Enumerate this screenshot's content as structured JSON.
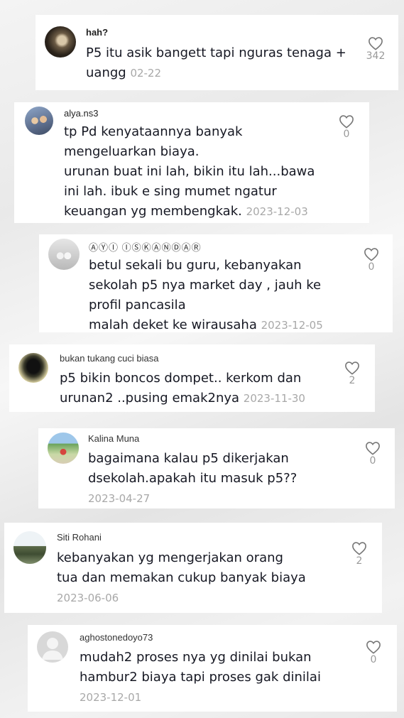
{
  "comments": [
    {
      "username": "hah?",
      "text": "P5 itu asik bangett tapi nguras tenaga +\nuangg",
      "date": "02-22",
      "likes": "342",
      "avatar": "user-photo"
    },
    {
      "username": "alya.ns3",
      "text": "tp Pd kenyataannya banyak\nmengeluarkan biaya.\nurunan buat ini lah, bikin itu lah...bawa\nini lah. ibuk e sing mumet ngatur\nkeuangan yg membengkak.",
      "date": "2023-12-03",
      "likes": "0",
      "avatar": "couple-photo"
    },
    {
      "username": "ⒶⓎⒾ ⒾⓈⓀⒶⓃⒹⒶⓇ",
      "text": "betul sekali bu guru, kebanyakan\nsekolah p5 nya market day , jauh ke\nprofil pancasila\nmalah deket ke wirausaha",
      "date": "2023-12-05",
      "likes": "0",
      "avatar": "couple-photo"
    },
    {
      "username": "bukan tukang cuci biasa",
      "text": "p5 bikin boncos dompet.. kerkom dan\nurunan2 ..pusing emak2nya",
      "date": "2023-11-30",
      "likes": "2",
      "avatar": "silhouette-photo"
    },
    {
      "username": "Kalina Muna",
      "text": "bagaimana kalau p5 dikerjakan\ndsekolah.apakah itu masuk p5??",
      "date": "2023-04-27",
      "likes": "0",
      "avatar": "outdoor-photo"
    },
    {
      "username": "Siti Rohani",
      "text": "kebanyakan yg mengerjakan orang\ntua dan memakan cukup banyak biaya",
      "date": "2023-06-06",
      "likes": "2",
      "avatar": "landscape-photo"
    },
    {
      "username": "aghostonedoyo73",
      "text": "mudah2 proses nya yg dinilai bukan\nhambur2 biaya tapi proses gak dinilai",
      "date": "2023-12-01",
      "likes": "0",
      "avatar": "default-avatar"
    }
  ]
}
